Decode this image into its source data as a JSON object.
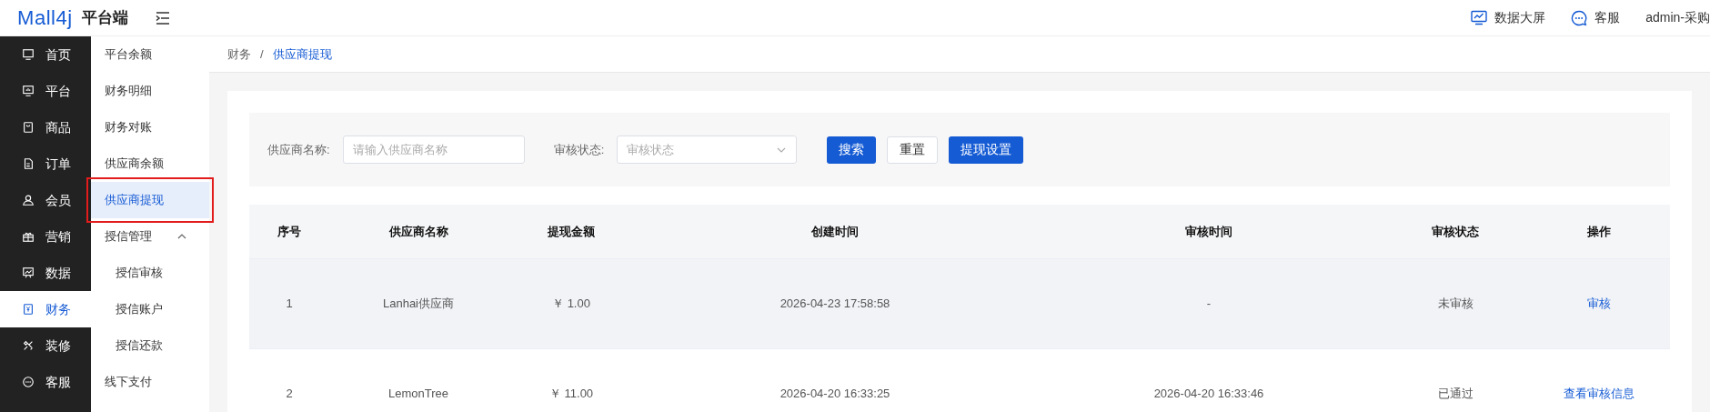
{
  "header": {
    "logo": "Mall4j",
    "app_name": "平台端",
    "actions": [
      {
        "kind": "screen",
        "label": "数据大屏"
      },
      {
        "kind": "chat",
        "label": "客服"
      }
    ],
    "user": "admin-采购"
  },
  "sidebar": {
    "items": [
      {
        "label": "首页",
        "selected": false
      },
      {
        "label": "平台",
        "selected": false
      },
      {
        "label": "商品",
        "selected": false
      },
      {
        "label": "订单",
        "selected": false
      },
      {
        "label": "会员",
        "selected": false
      },
      {
        "label": "营销",
        "selected": false
      },
      {
        "label": "数据",
        "selected": false
      },
      {
        "label": "财务",
        "selected": true
      },
      {
        "label": "装修",
        "selected": false
      },
      {
        "label": "客服",
        "selected": false
      }
    ]
  },
  "submenu": {
    "items": [
      {
        "label": "平台余额",
        "selected": false
      },
      {
        "label": "财务明细",
        "selected": false
      },
      {
        "label": "财务对账",
        "selected": false
      },
      {
        "label": "供应商余额",
        "selected": false
      },
      {
        "label": "供应商提现",
        "selected": true,
        "annotated": true
      },
      {
        "label": "授信管理",
        "selected": false,
        "expanded": true,
        "children": [
          {
            "label": "授信审核",
            "selected": false
          },
          {
            "label": "授信账户",
            "selected": false
          },
          {
            "label": "授信还款",
            "selected": false
          }
        ]
      },
      {
        "label": "线下支付",
        "selected": false
      }
    ]
  },
  "breadcrumb": [
    "财务",
    "/",
    "供应商提现"
  ],
  "search": {
    "fields": [
      {
        "kind": "input",
        "label": "供应商名称:",
        "placeholder": "请输入供应商名称"
      },
      {
        "kind": "select",
        "label": "审核状态:",
        "placeholder": "审核状态"
      }
    ],
    "buttons": [
      {
        "kind": "primary",
        "label": "搜索"
      },
      {
        "kind": "default",
        "label": "重置"
      },
      {
        "kind": "primary",
        "label": "提现设置"
      }
    ]
  },
  "table": {
    "columns": [
      "序号",
      "供应商名称",
      "提现金额",
      "创建时间",
      "审核时间",
      "审核状态",
      "操作"
    ],
    "rows": [
      {
        "highlighted": true,
        "cells": [
          "1",
          "Lanhai供应商",
          "￥ 1.00",
          "2026-04-23 17:58:58",
          "-",
          "未审核"
        ],
        "action": "审核"
      },
      {
        "highlighted": false,
        "cells": [
          "2",
          "LemonTree",
          "￥ 11.00",
          "2026-04-20 16:33:25",
          "2026-04-20 16:33:46",
          "已通过"
        ],
        "action": "查看审核信息"
      }
    ]
  }
}
